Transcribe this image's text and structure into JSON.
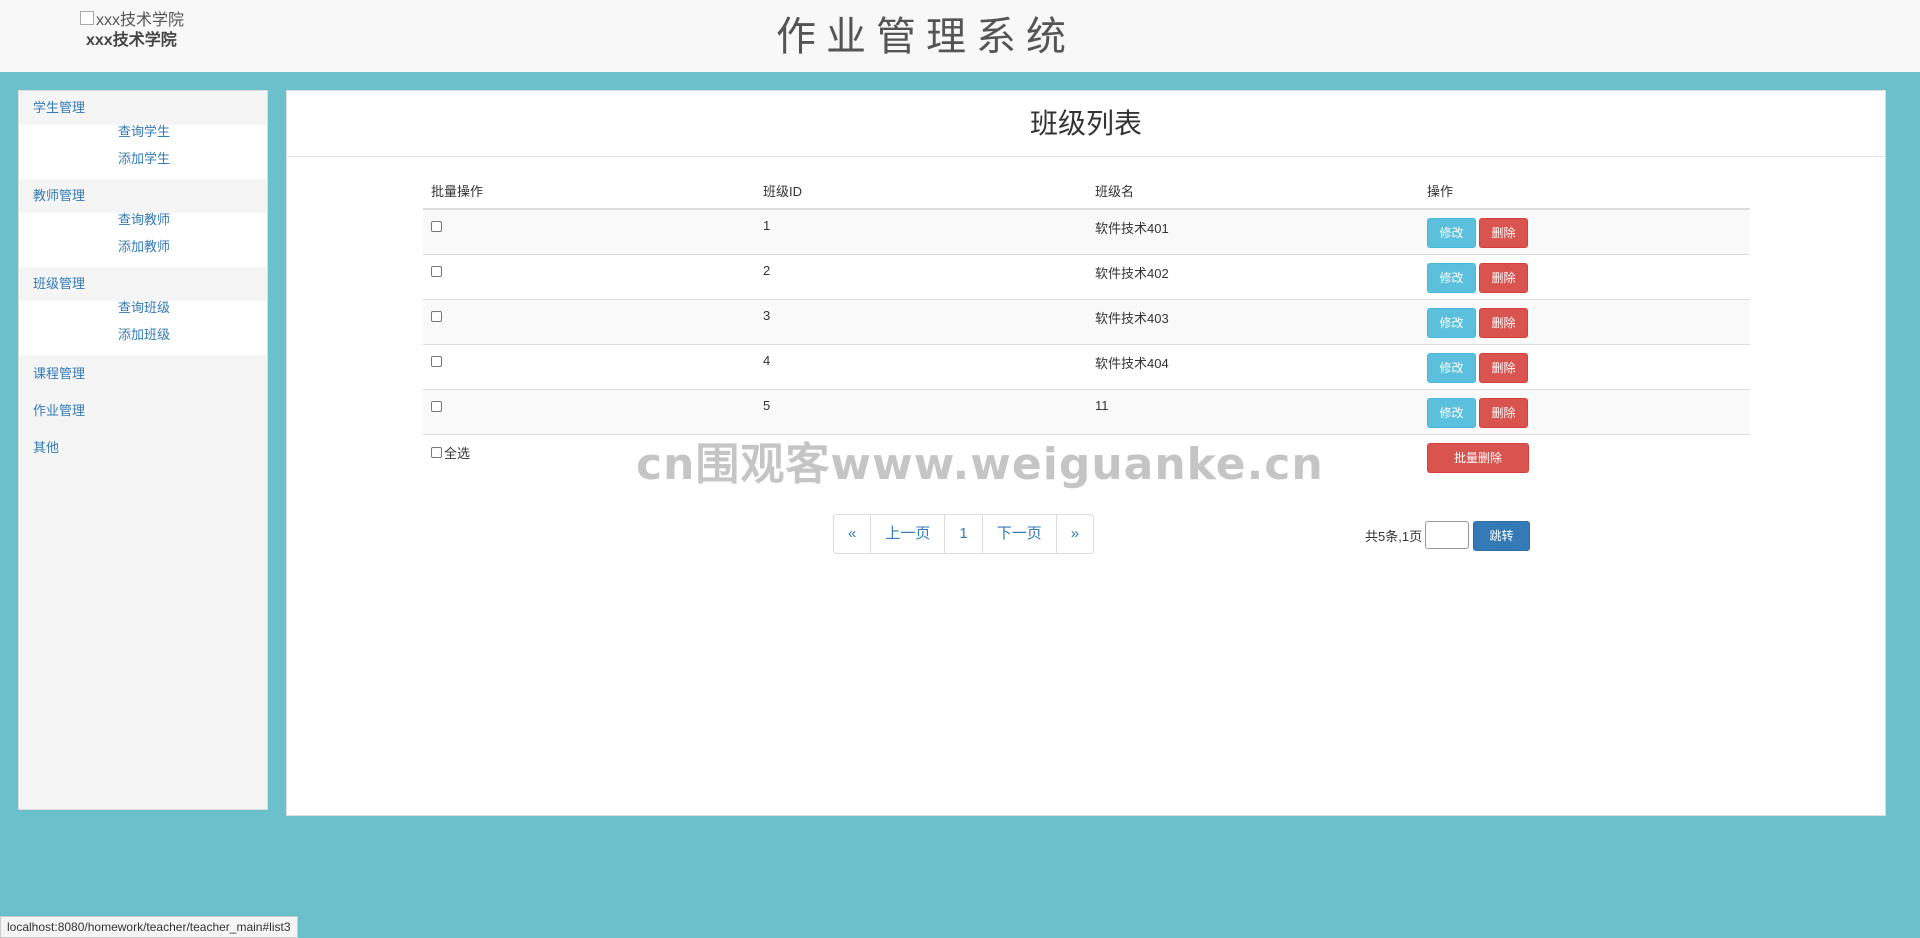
{
  "header": {
    "logo_alt": "xxx技术学院",
    "school_name": "xxx技术学院",
    "app_title": "作业管理系统"
  },
  "sidebar": {
    "groups": [
      {
        "title": "学生管理",
        "items": [
          "查询学生",
          "添加学生"
        ]
      },
      {
        "title": "教师管理",
        "items": [
          "查询教师",
          "添加教师"
        ]
      },
      {
        "title": "班级管理",
        "items": [
          "查询班级",
          "添加班级"
        ]
      }
    ],
    "plain": [
      "课程管理",
      "作业管理",
      "其他"
    ]
  },
  "main": {
    "title": "班级列表",
    "columns": [
      "批量操作",
      "班级ID",
      "班级名",
      "操作"
    ],
    "rows": [
      {
        "id": "1",
        "name": "软件技术401"
      },
      {
        "id": "2",
        "name": "软件技术402"
      },
      {
        "id": "3",
        "name": "软件技术403"
      },
      {
        "id": "4",
        "name": "软件技术404"
      },
      {
        "id": "5",
        "name": "11"
      }
    ],
    "edit_label": "修改",
    "delete_label": "删除",
    "select_all_label": "全选",
    "batch_delete_label": "批量删除"
  },
  "pagination": {
    "first": "«",
    "prev": "上一页",
    "current": "1",
    "next": "下一页",
    "last": "»",
    "info": "共5条,1页",
    "jump_label": "跳转"
  },
  "watermark": "cn围观客www.weiguanke.cn",
  "statusbar": "localhost:8080/homework/teacher/teacher_main#list3",
  "colors": {
    "background": "#6ac0cb",
    "link": "#337ab7",
    "info": "#5bc0de",
    "danger": "#d9534f",
    "primary": "#337ab7"
  }
}
